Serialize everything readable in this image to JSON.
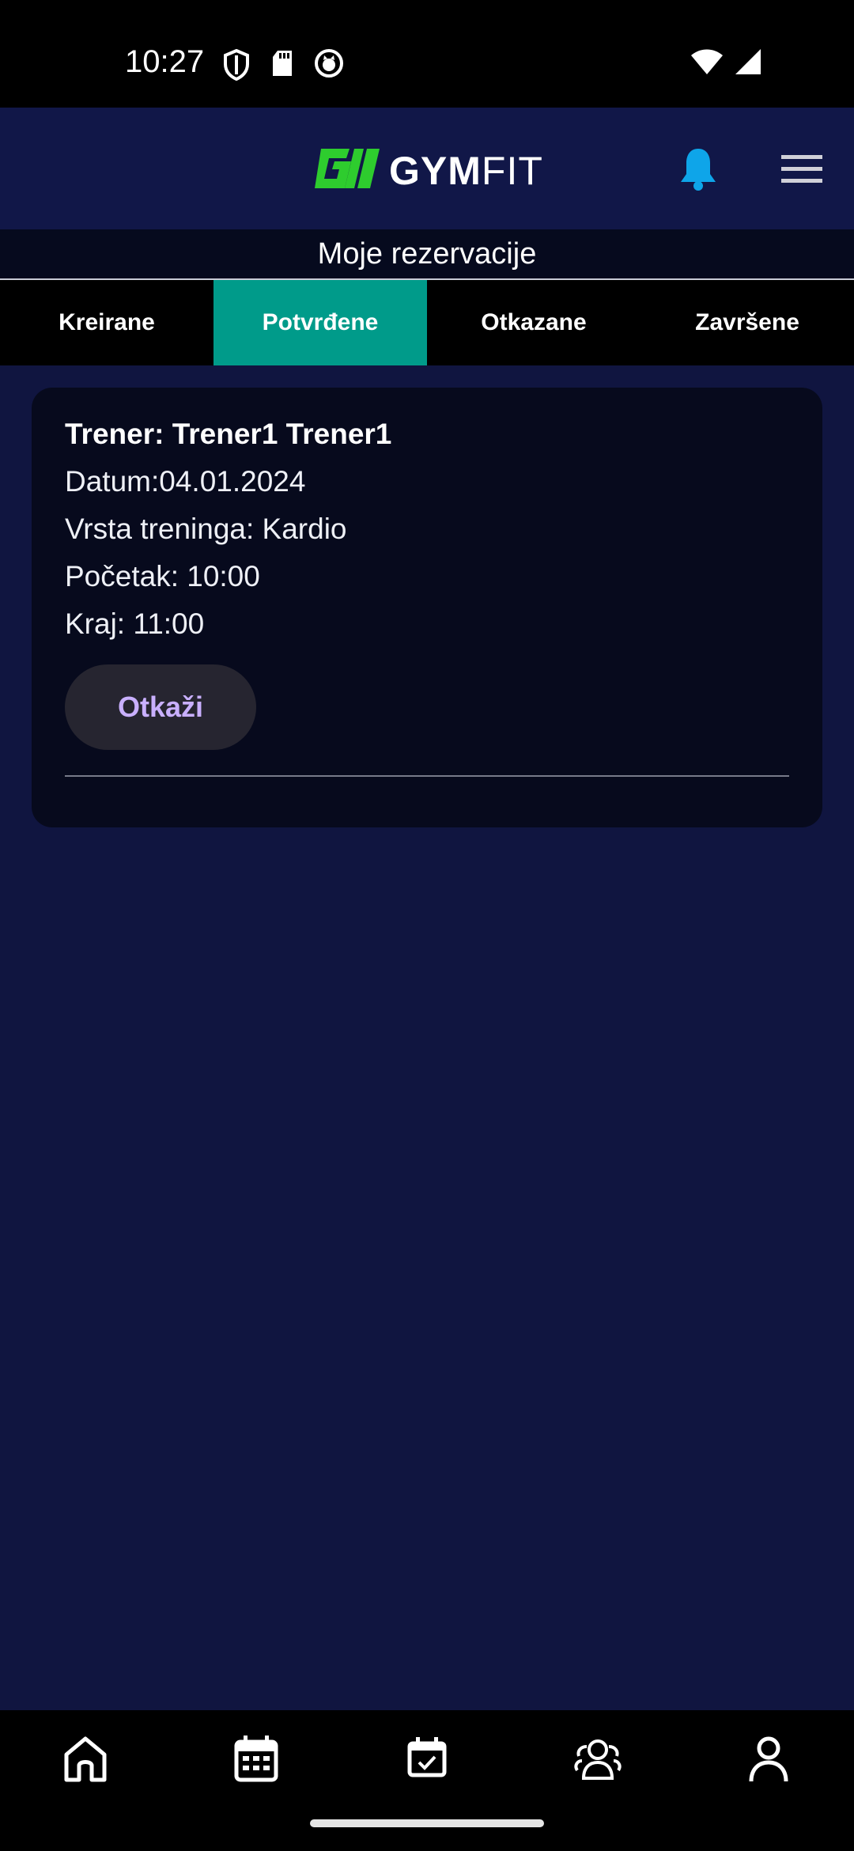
{
  "status_bar": {
    "time": "10:27",
    "left_icons": [
      "shield-icon",
      "sd-card-icon",
      "cat-icon"
    ],
    "right_icons": [
      "wifi-icon",
      "signal-icon"
    ]
  },
  "header": {
    "logo_text_bold": "GYM",
    "logo_text_light": "FIT",
    "logo_color": "#2ecc2e",
    "bell_color": "#0ea5e9"
  },
  "page": {
    "title": "Moje rezervacije"
  },
  "tabs": [
    {
      "label": "Kreirane",
      "active": false
    },
    {
      "label": "Potvrđene",
      "active": true
    },
    {
      "label": "Otkazane",
      "active": false
    },
    {
      "label": "Završene",
      "active": false
    }
  ],
  "reservation": {
    "trainer": "Trener: Trener1 Trener1",
    "date": "Datum:04.01.2024",
    "type": "Vrsta treninga: Kardio",
    "start": "Početak: 10:00",
    "end": "Kraj: 11:00",
    "cancel_label": "Otkaži"
  },
  "bottom_nav": [
    "home-icon",
    "calendar-icon",
    "calendar-check-icon",
    "group-icon",
    "profile-icon"
  ],
  "colors": {
    "background": "#101540",
    "active_tab": "#009b8a",
    "cancel_text": "#c9b0ff"
  }
}
